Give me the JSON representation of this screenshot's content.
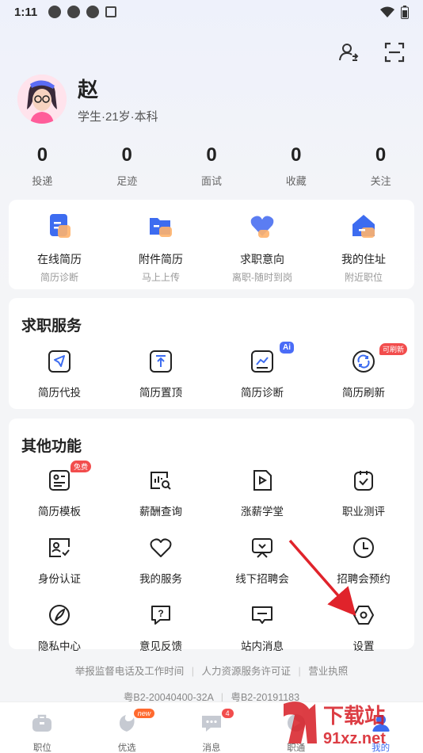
{
  "status_bar": {
    "time": "1:11"
  },
  "profile": {
    "name": "赵",
    "subtitle": "学生·21岁·本科"
  },
  "stats": [
    {
      "count": "0",
      "label": "投递"
    },
    {
      "count": "0",
      "label": "足迹"
    },
    {
      "count": "0",
      "label": "面试"
    },
    {
      "count": "0",
      "label": "收藏"
    },
    {
      "count": "0",
      "label": "关注"
    }
  ],
  "quick": [
    {
      "label": "在线简历",
      "sub": "简历诊断"
    },
    {
      "label": "附件简历",
      "sub": "马上上传"
    },
    {
      "label": "求职意向",
      "sub": "离职-随时到岗"
    },
    {
      "label": "我的住址",
      "sub": "附近职位"
    }
  ],
  "job_service": {
    "title": "求职服务",
    "items": [
      {
        "label": "简历代投"
      },
      {
        "label": "简历置顶"
      },
      {
        "label": "简历诊断",
        "badge": "Ai"
      },
      {
        "label": "简历刷新",
        "badge": "可刷新"
      }
    ]
  },
  "other_features": {
    "title": "其他功能",
    "items": [
      {
        "label": "简历模板",
        "badge": "免费"
      },
      {
        "label": "薪酬查询"
      },
      {
        "label": "涨薪学堂"
      },
      {
        "label": "职业测评"
      },
      {
        "label": "身份认证"
      },
      {
        "label": "我的服务"
      },
      {
        "label": "线下招聘会"
      },
      {
        "label": "招聘会预约"
      },
      {
        "label": "隐私中心"
      },
      {
        "label": "意见反馈"
      },
      {
        "label": "站内消息"
      },
      {
        "label": "设置"
      }
    ]
  },
  "footer": {
    "line1": [
      "举报监督电话及工作时间",
      "人力资源服务许可证",
      "营业执照"
    ],
    "line2": [
      "粤B2-20040400-32A",
      "粤B2-20191183"
    ]
  },
  "tabbar": [
    {
      "label": "职位"
    },
    {
      "label": "优选",
      "badge": "new"
    },
    {
      "label": "消息",
      "badge": "4"
    },
    {
      "label": "职通"
    },
    {
      "label": "我的"
    }
  ],
  "watermark": {
    "text": "下载站",
    "domain": "91xz.net"
  },
  "colors": {
    "accent_blue": "#3d6cf0",
    "badge_red": "#f24d4d",
    "arrow_red": "#e0232b"
  }
}
